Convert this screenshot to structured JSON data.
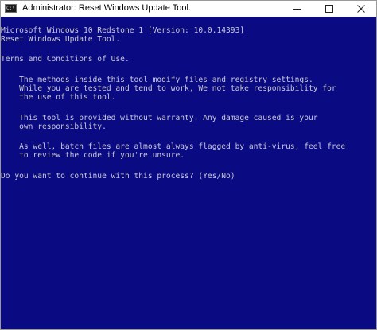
{
  "window": {
    "title": "Administrator:  Reset Windows Update Tool.",
    "icon_label": "C:\\",
    "icons": [
      "console-app-icon",
      "minimize-icon",
      "maximize-icon",
      "close-icon"
    ]
  },
  "console": {
    "lines": [
      "Microsoft Windows 10 Redstone 1 [Version: 10.0.14393]",
      "Reset Windows Update Tool.",
      "Terms and Conditions of Use.",
      "    The methods inside this tool modify files and registry settings.",
      "    While you are tested and tend to work, We not take responsibility for",
      "    the use of this tool.",
      "    This tool is provided without warranty. Any damage caused is your",
      "    own responsibility.",
      "    As well, batch files are almost always flagged by anti-virus, feel free",
      "    to review the code if you're unsure.",
      "Do you want to continue with this process? (Yes/No)"
    ]
  },
  "colors": {
    "console_background": "#0a0a82",
    "console_text": "#c9c9d6",
    "titlebar": "#ffffff"
  }
}
